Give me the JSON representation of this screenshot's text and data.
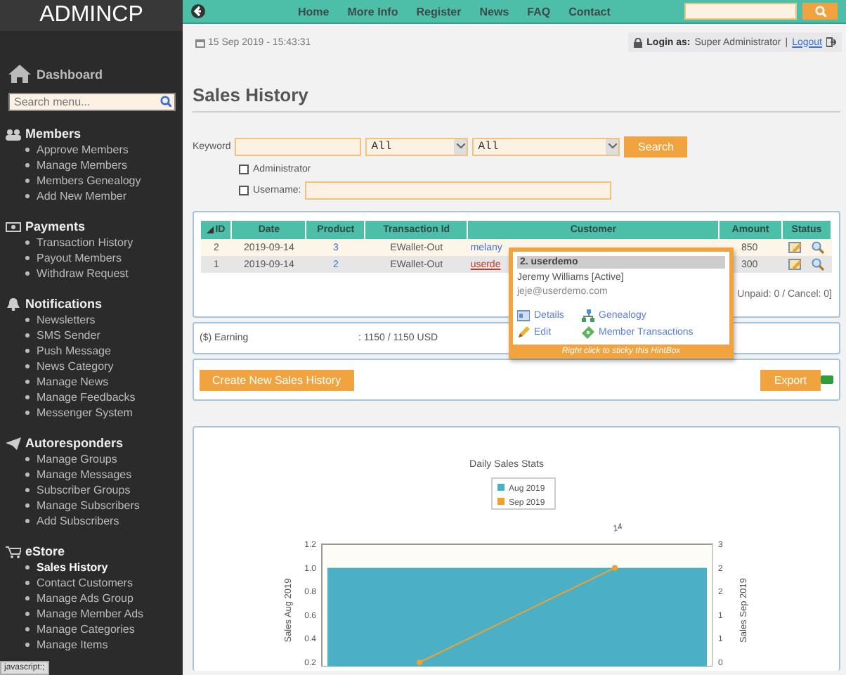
{
  "sidebar": {
    "logo": "ADMINCP",
    "dashboard": "Dashboard",
    "search": {
      "placeholder": "Search menu..."
    },
    "sections": [
      {
        "kind": "members",
        "title": "Members",
        "items": [
          {
            "label": "Approve Members",
            "selected": false
          },
          {
            "label": "Manage Members",
            "selected": false
          },
          {
            "label": "Members Genealogy",
            "selected": false
          },
          {
            "label": "Add New Member",
            "selected": false
          }
        ]
      },
      {
        "kind": "payments",
        "title": "Payments",
        "items": [
          {
            "label": "Transaction History",
            "selected": false
          },
          {
            "label": "Payout Members",
            "selected": false
          },
          {
            "label": "Withdraw Request",
            "selected": false
          }
        ]
      },
      {
        "kind": "notifications",
        "title": "Notifications",
        "items": [
          {
            "label": "Newsletters",
            "selected": false
          },
          {
            "label": "SMS Sender",
            "selected": false
          },
          {
            "label": "Push Message",
            "selected": false
          },
          {
            "label": "News Category",
            "selected": false
          },
          {
            "label": "Manage News",
            "selected": false
          },
          {
            "label": "Manage Feedbacks",
            "selected": false
          },
          {
            "label": "Messenger System",
            "selected": false
          }
        ]
      },
      {
        "kind": "autoresponders",
        "title": "Autoresponders",
        "items": [
          {
            "label": "Manage Groups",
            "selected": false
          },
          {
            "label": "Manage Messages",
            "selected": false
          },
          {
            "label": "Subscriber Groups",
            "selected": false
          },
          {
            "label": "Manage Subscribers",
            "selected": false
          },
          {
            "label": "Add Subscribers",
            "selected": false
          }
        ]
      },
      {
        "kind": "estore",
        "title": "eStore",
        "items": [
          {
            "label": "Sales History",
            "selected": true
          },
          {
            "label": "Contact Customers",
            "selected": false
          },
          {
            "label": "Manage Ads Group",
            "selected": false
          },
          {
            "label": "Manage Member Ads",
            "selected": false
          },
          {
            "label": "Manage Categories",
            "selected": false
          },
          {
            "label": "Manage Items",
            "selected": false
          }
        ]
      }
    ]
  },
  "topnav": {
    "links": [
      "Home",
      "More Info",
      "Register",
      "News",
      "FAQ",
      "Contact"
    ]
  },
  "info_bar": {
    "datetime": "15 Sep 2019 - 15:43:31",
    "login_label": "Login as:",
    "login_user": "Super Administrator",
    "separator": "|",
    "logout": "Logout"
  },
  "page_title": "Sales History",
  "filters": {
    "keyword_label": "Keyword",
    "select_1": "All",
    "select_2": "All",
    "search_button": "Search",
    "checkboxes": [
      {
        "kind": "plain",
        "label": "Administrator",
        "checked": false
      },
      {
        "kind": "with-field",
        "label": "Username:",
        "checked": false
      }
    ]
  },
  "table": {
    "columns": [
      "ID",
      "Date",
      "Product",
      "Transaction Id",
      "Customer",
      "Amount",
      "Status"
    ],
    "rows": [
      {
        "id": "2",
        "date": "2019-09-14",
        "product": "3",
        "transaction_id": "EWallet-Out",
        "customer": "melany",
        "amount": "850",
        "hovered": false
      },
      {
        "id": "1",
        "date": "2019-09-14",
        "product": "2",
        "transaction_id": "EWallet-Out",
        "customer": "userde",
        "amount": "300",
        "hovered": true
      }
    ],
    "records": "Unpaid: 0 / Cancel: 0]"
  },
  "hintbox": {
    "title": "2. userdemo",
    "name": "Jeremy Williams [Active]",
    "email": "jeje@userdemo.com",
    "actions": [
      {
        "kind": "details",
        "label": "Details"
      },
      {
        "kind": "genealogy",
        "label": "Genealogy"
      },
      {
        "kind": "edit",
        "label": "Edit"
      },
      {
        "kind": "transactions",
        "label": "Member Transactions"
      }
    ],
    "footer": "Right click to sticky this HintBox"
  },
  "earning": {
    "label": "($) Earning",
    "value": ": 1150 / 1150 USD"
  },
  "actions": {
    "create_button": "Create New Sales History",
    "export_button": "Export"
  },
  "chart": {
    "chart_data": {
      "type": "bar",
      "title": "Daily Sales Stats",
      "categories": [
        null
      ],
      "ylabel": "Sales Aug 2019",
      "ylim": [
        0.2,
        1.2
      ],
      "yticks": [
        0.2,
        0.4,
        0.6,
        0.8,
        {
          "value": 1.0,
          "label": "1.0"
        },
        1.2
      ],
      "series": [
        {
          "name": "Aug 2019",
          "color": "#4bafc6",
          "values": [
            1
          ]
        }
      ],
      "annotations": [
        "14"
      ]
    },
    "line_overlay": {
      "name": "Sep 2019",
      "color": "#f0a22e",
      "axis_label": "Sales Sep 2019",
      "axis_labels": [
        "3",
        "2",
        "2",
        "1",
        "1",
        "0"
      ]
    }
  },
  "status_bar": "javascript:;"
}
